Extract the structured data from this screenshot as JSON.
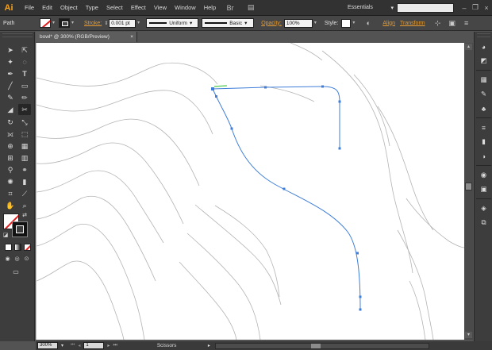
{
  "app": {
    "logo": "Ai"
  },
  "menu": [
    "File",
    "Edit",
    "Object",
    "Type",
    "Select",
    "Effect",
    "View",
    "Window",
    "Help"
  ],
  "workspace": {
    "label": "Essentials"
  },
  "control": {
    "selection_label": "Path",
    "stroke_link": "Stroke:",
    "stroke_weight": "0.001 pt",
    "profile": "Uniform",
    "brush": "Basic",
    "opacity_link": "Opacity:",
    "opacity_value": "100%",
    "style_label": "Style:",
    "align_link": "Align",
    "transform_link": "Transform"
  },
  "document": {
    "tab_title": "bowl* @ 300% (RGB/Preview)",
    "close": "×"
  },
  "status": {
    "zoom": "300%",
    "artboard": "1",
    "current_tool": "Scissors"
  },
  "icons": {
    "bridge": "Br",
    "arrange": "▤",
    "win_min": "–",
    "win_max": "❐",
    "win_close": "×",
    "dropdown": "▾",
    "scroll_up": "▴",
    "scroll_down": "▾"
  },
  "colors": {
    "accent": "#f7a21b",
    "path": "#3f7ed8",
    "contours": "#b3b3b3"
  }
}
